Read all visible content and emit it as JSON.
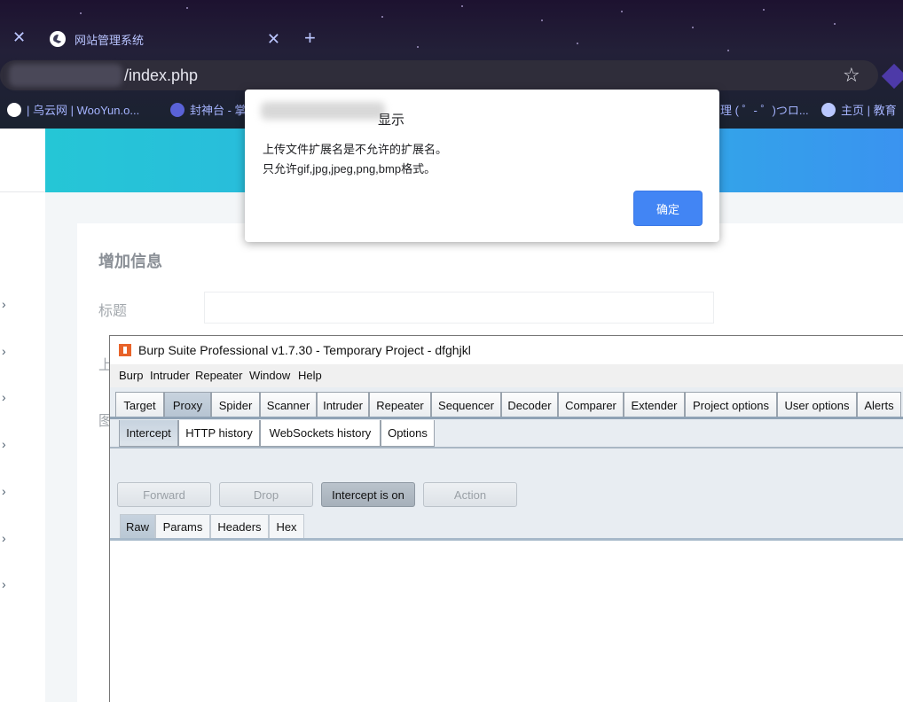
{
  "browser": {
    "tab_title": "网站管理系统",
    "url": "/index.php",
    "bookmarks": [
      "| 乌云网 | WooYun.o...",
      "封神台 - 掌...",
      "理 ( ゜- ゜)つロ...",
      "主页 | 教育"
    ]
  },
  "page": {
    "section_title": "增加信息",
    "title_label": "标题",
    "partial_label_1": "上",
    "partial_label_2": "图"
  },
  "alert": {
    "title_suffix": "显示",
    "message_line1": "上传文件扩展名是不允许的扩展名。",
    "message_line2": "只允许gif,jpg,jpeg,png,bmp格式。",
    "ok_label": "确定"
  },
  "burp": {
    "title": "Burp Suite Professional v1.7.30 - Temporary Project - dfghjkl",
    "menu": [
      "Burp",
      "Intruder",
      "Repeater",
      "Window",
      "Help"
    ],
    "main_tabs": [
      "Target",
      "Proxy",
      "Spider",
      "Scanner",
      "Intruder",
      "Repeater",
      "Sequencer",
      "Decoder",
      "Comparer",
      "Extender",
      "Project options",
      "User options",
      "Alerts"
    ],
    "main_selected": "Proxy",
    "proxy_tabs": [
      "Intercept",
      "HTTP history",
      "WebSockets history",
      "Options"
    ],
    "proxy_selected": "Intercept",
    "buttons": {
      "forward": "Forward",
      "drop": "Drop",
      "intercept": "Intercept is on",
      "action": "Action"
    },
    "message_tabs": [
      "Raw",
      "Params",
      "Headers",
      "Hex"
    ],
    "message_selected": "Raw"
  },
  "colors": {
    "header_gradient_start": "#25c6d6",
    "header_gradient_end": "#3a93f0",
    "alert_button": "#4285f4",
    "burp_logo": "#e8632a"
  }
}
